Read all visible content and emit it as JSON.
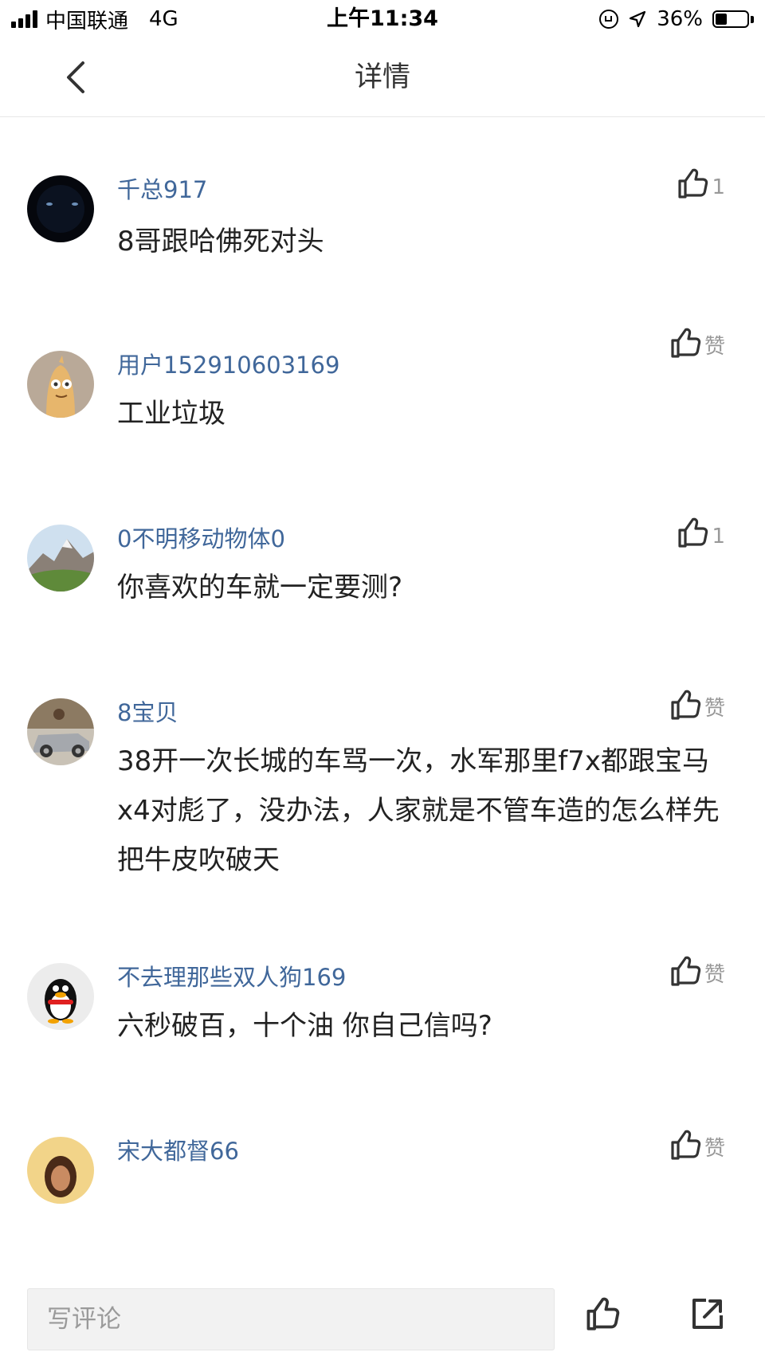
{
  "status_bar": {
    "carrier": "中国联通",
    "network": "4G",
    "time": "上午11:34",
    "battery_text": "36%",
    "battery_level": 0.36
  },
  "nav": {
    "title": "详情",
    "back_icon": "chevron-left-icon"
  },
  "comments": [
    {
      "username": "千总917",
      "text": "8哥跟哈佛死对头",
      "like": "1",
      "avatar": "dark-cat-avatar"
    },
    {
      "username": "用户152910603169",
      "text": "工业垃圾",
      "like": "赞",
      "avatar": "cartoon-character-avatar"
    },
    {
      "username": "0不明移动物体0",
      "text": "你喜欢的车就一定要测?",
      "like": "1",
      "avatar": "mountain-landscape-avatar"
    },
    {
      "username": "8宝贝",
      "text": "38开一次长城的车骂一次，水军那里f7x都跟宝马x4对彪了，没办法，人家就是不管车造的怎么样先把牛皮吹破天",
      "like": "赞",
      "avatar": "car-photo-avatar"
    },
    {
      "username": "不去理那些双人狗169",
      "text": "六秒破百，十个油 你自己信吗?",
      "like": "赞",
      "avatar": "penguin-avatar"
    },
    {
      "username": "宋大都督66",
      "text": "",
      "like": "赞",
      "avatar": "person-photo-avatar"
    }
  ],
  "bottom_bar": {
    "input_placeholder": "写评论",
    "like_icon": "thumbs-up-icon",
    "share_icon": "share-icon"
  },
  "colors": {
    "username": "#40679a",
    "muted": "#999999",
    "input_bg": "#f2f2f2"
  }
}
